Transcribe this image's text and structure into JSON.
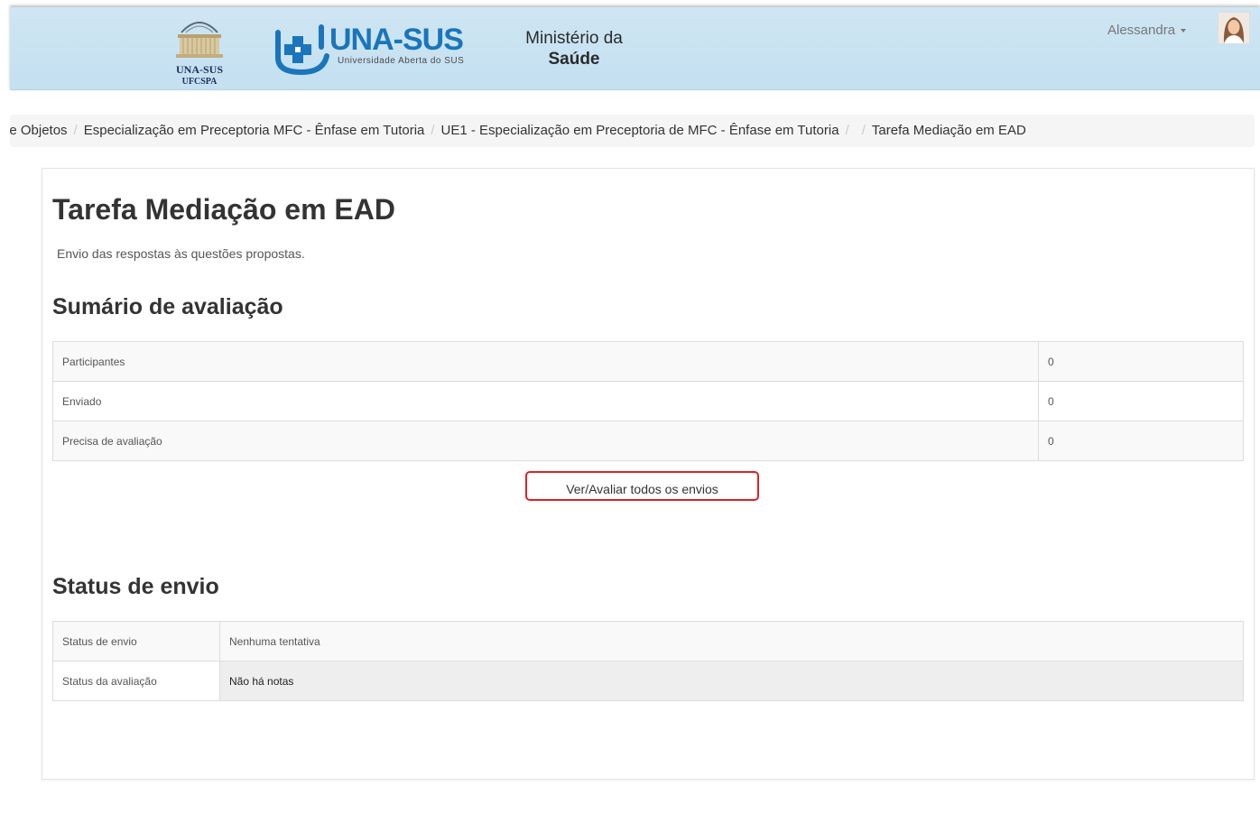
{
  "header": {
    "ufcspa_logo": {
      "line1": "UNA-SUS",
      "line2": "UFCSPA"
    },
    "unasus_logo": {
      "name": "UNA-SUS",
      "subtitle": "Universidade Aberta do SUS"
    },
    "ministerio": {
      "line1": "Ministério da",
      "line2": "Saúde"
    },
    "user_name": "Alessandra"
  },
  "breadcrumb": {
    "items": [
      "de Objetos",
      "Especialização em Preceptoria MFC - Ênfase em Tutoria",
      "UE1 - Especialização em Preceptoria de MFC - Ênfase em Tutoria",
      "",
      "Tarefa Mediação em EAD"
    ]
  },
  "page": {
    "title": "Tarefa Mediação em EAD",
    "intro": "Envio das respostas às questões propostas.",
    "summary_heading": "Sumário de avaliação",
    "summary_rows": [
      {
        "label": "Participantes",
        "value": "0"
      },
      {
        "label": "Enviado",
        "value": "0"
      },
      {
        "label": "Precisa de avaliação",
        "value": "0"
      }
    ],
    "view_all_button": "Ver/Avaliar todos os envios",
    "status_heading": "Status de envio",
    "status_rows": [
      {
        "label": "Status de envio",
        "value": "Nenhuma tentativa"
      },
      {
        "label": "Status da avaliação",
        "value": "Não há notas"
      }
    ]
  },
  "colors": {
    "header_bg": "#c6e1f1",
    "brand_blue": "#1a75bb",
    "button_border": "#e21f26"
  },
  "icons": [
    "ufcspa-building-logo",
    "unasus-cross-logo",
    "caret-down-icon",
    "user-avatar"
  ]
}
